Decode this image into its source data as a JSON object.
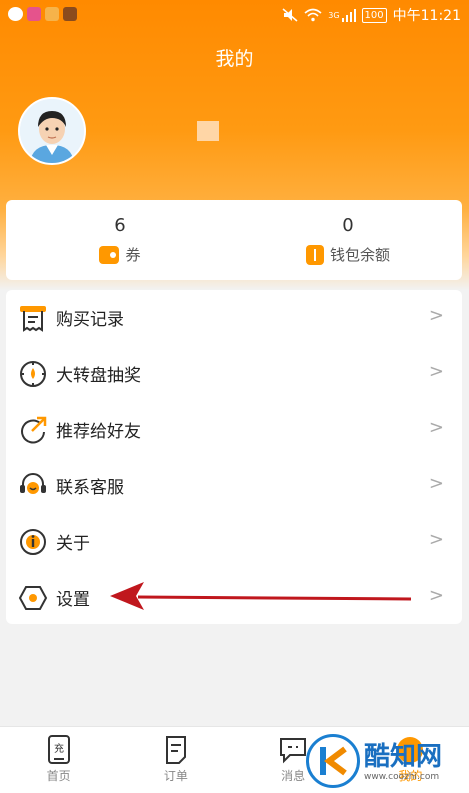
{
  "status_bar": {
    "carrier": "3G",
    "battery": "100",
    "time": "中午11:21"
  },
  "header": {
    "title": "我的"
  },
  "stats": [
    {
      "value": "6",
      "label": "券"
    },
    {
      "value": "0",
      "label": "钱包余额"
    }
  ],
  "menu": [
    {
      "label": "购买记录",
      "icon": "receipt-icon"
    },
    {
      "label": "大转盘抽奖",
      "icon": "wheel-icon"
    },
    {
      "label": "推荐给好友",
      "icon": "share-icon"
    },
    {
      "label": "联系客服",
      "icon": "headset-icon"
    },
    {
      "label": "关于",
      "icon": "info-icon"
    },
    {
      "label": "设置",
      "icon": "settings-hexagon-icon"
    }
  ],
  "bottom_nav": [
    {
      "label": "首页",
      "icon_text": "充",
      "active": false
    },
    {
      "label": "订单",
      "active": false
    },
    {
      "label": "消息",
      "active": false
    },
    {
      "label": "我的",
      "active": true
    }
  ],
  "watermark": {
    "text": "酷知网",
    "url": "www.coozhi.com"
  },
  "colors": {
    "accent": "#ff9800",
    "header_top": "#ff8a00",
    "arrow": "#c0171d"
  }
}
